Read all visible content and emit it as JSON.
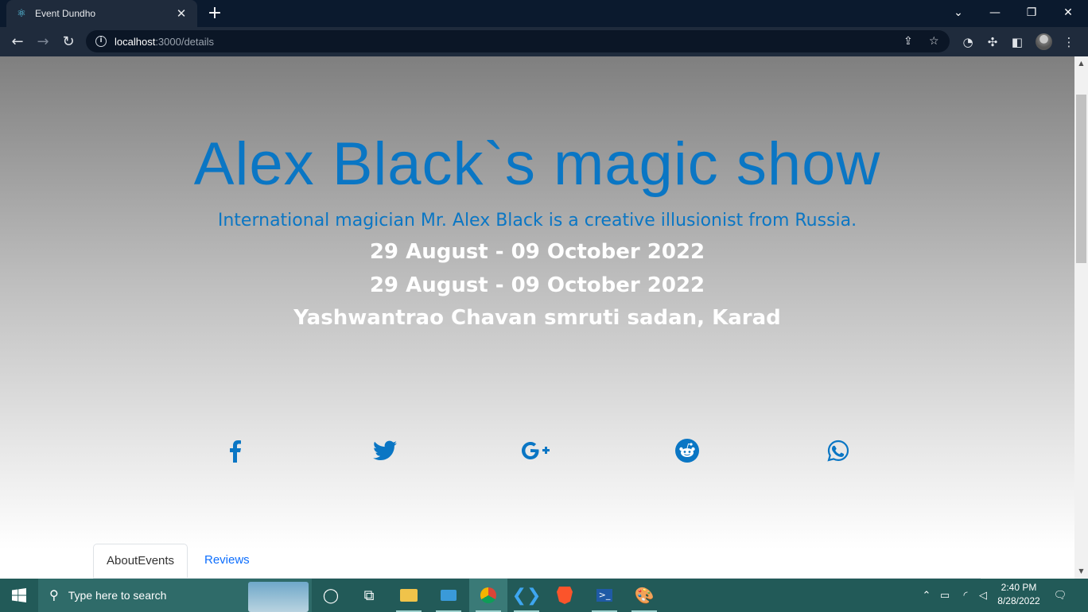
{
  "browser": {
    "tab_title": "Event Dundho",
    "tab_icon": "react-icon",
    "new_tab": "+",
    "url_host": "localhost",
    "url_path": ":3000/details",
    "window_controls": [
      "minimize",
      "restore",
      "close"
    ]
  },
  "hero": {
    "title": "Alex Black`s magic show",
    "subtitle": "International magician Mr. Alex Black is a creative illusionist from Russia.",
    "date_line_1": "29 August - 09 October 2022",
    "date_line_2": "29 August - 09 October 2022",
    "venue": "Yashwantrao Chavan smruti sadan, Karad",
    "social": [
      "facebook-icon",
      "twitter-icon",
      "google-plus-icon",
      "reddit-icon",
      "whatsapp-icon"
    ],
    "accent_color": "#0a76c4"
  },
  "tabs": {
    "about": "AboutEvents",
    "reviews": "Reviews"
  },
  "taskbar": {
    "search_placeholder": "Type here to search",
    "time": "2:40 PM",
    "date": "8/28/2022"
  }
}
